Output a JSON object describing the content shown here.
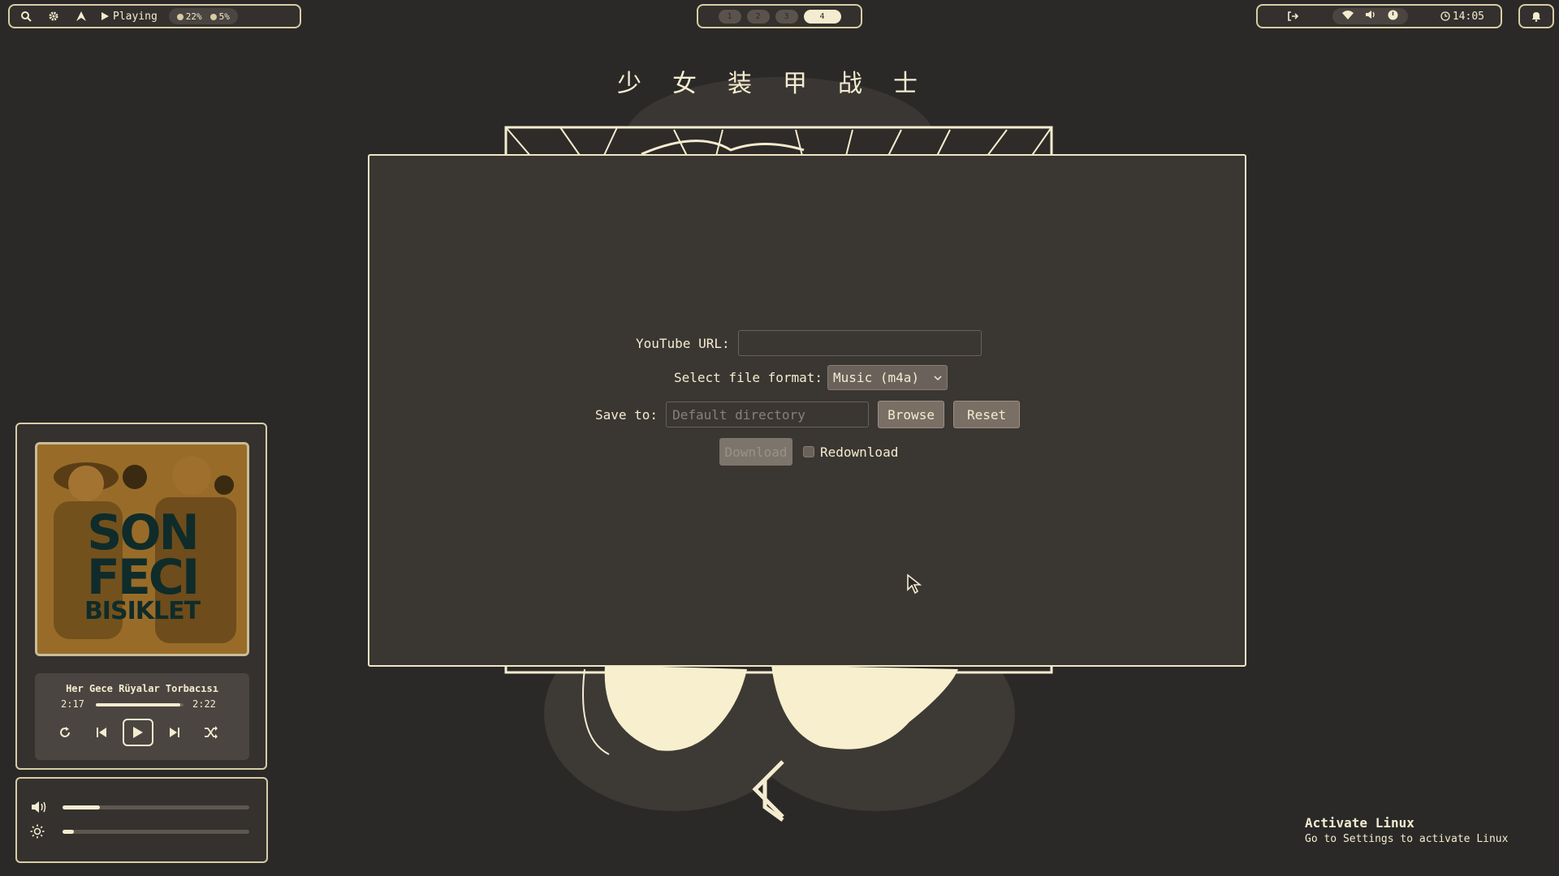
{
  "topbar": {
    "left": {
      "playing_label": "Playing",
      "cpu_label": "22%",
      "ram_label": "5%",
      "icons": [
        "search-icon",
        "gear-icon",
        "arch-logo-icon",
        "play-icon"
      ]
    },
    "workspaces": [
      "1",
      "2",
      "3",
      "4"
    ],
    "active_workspace": "4",
    "right": {
      "clock": "14:05",
      "icons": [
        "logout-icon",
        "wifi-icon",
        "volume-icon",
        "power-icon",
        "clock-icon",
        "bell-icon"
      ]
    }
  },
  "background": {
    "title": "少女装甲战士"
  },
  "form": {
    "url_label": "YouTube URL:",
    "url_value": "",
    "format_label": "Select file format:",
    "format_selected": "Music (m4a)",
    "save_label": "Save to:",
    "save_placeholder": "Default directory",
    "browse_label": "Browse",
    "reset_label": "Reset",
    "download_label": "Download",
    "redownload_label": "Redownload",
    "redownload_checked": false
  },
  "media": {
    "album_text": [
      "SON",
      "FECI",
      "BISIKLET"
    ],
    "track_title": "Her Gece Rüyalar Torbacısı",
    "elapsed": "2:17",
    "duration": "2:22",
    "progress": 0.965
  },
  "sliders": {
    "volume": 0.2,
    "brightness": 0.06
  },
  "watermark": {
    "title": "Activate Linux",
    "subtitle": "Go to Settings to activate Linux"
  },
  "colors": {
    "background": "#2b2927",
    "accent": "#f4ecd0",
    "panel": "#3a3632",
    "button": "#7a6f65"
  }
}
